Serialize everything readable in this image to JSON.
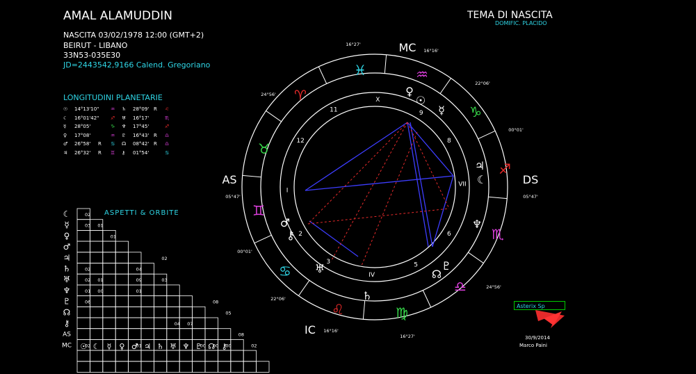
{
  "header": {
    "name": "AMAL ALAMUDDIN",
    "birth": "NASCITA 03/02/1978 12:00 (GMT+2)",
    "place": "BEIRUT - LIBANO",
    "coords": "33N53-035E30",
    "jd": "JD=2443542,9166  Calend. Gregoriano"
  },
  "chart_header": {
    "title": "TEMA DI NASCITA",
    "subtitle": "DOMIFIC. PLACIDO"
  },
  "longitudes": {
    "title": "LONGITUDINI PLANETARIE",
    "rows": [
      [
        "14°13'10\"",
        "",
        "28°09'",
        "R",
        "16°01'42\"",
        "",
        "16°17'",
        "",
        "28°05'",
        "",
        "17°45'",
        "",
        "17°08'",
        "",
        "16°43'",
        "R",
        "26°58'",
        "R",
        "08°42'",
        "R",
        "26°32'",
        "R",
        "01°54'",
        ""
      ]
    ],
    "r1": [
      "14°13'10\"",
      "28°09'",
      "R"
    ],
    "r2": [
      "16°01'42\"",
      "16°17'",
      ""
    ],
    "r3": [
      "28°05'",
      "17°45'",
      ""
    ],
    "r4": [
      "17°08'",
      "16°43'",
      "R"
    ],
    "r5": [
      "26°58'",
      "R",
      "08°42'",
      "R"
    ],
    "r6": [
      "26°32'",
      "R",
      "01°54'",
      ""
    ]
  },
  "aspects": {
    "title": "ASPETTI  &  ORBITE",
    "row_labels": [
      "AS",
      "MC"
    ],
    "cells": [
      "02",
      "03",
      "01",
      "01",
      "02",
      "02",
      "04",
      "02",
      "01",
      "09",
      "03",
      "01",
      "00",
      "01",
      "06",
      "08",
      "05",
      "04",
      "07",
      "08",
      "02",
      "00",
      "01",
      "00",
      "00",
      "02"
    ]
  },
  "wheel": {
    "angles": {
      "mc": "MC",
      "ic": "IC",
      "as": "AS",
      "ds": "DS"
    },
    "degrees": [
      "16°27'",
      "16°16'",
      "22°06'",
      "24°56'",
      "00°01'",
      "05°47'",
      "05°47'",
      "00°01'",
      "24°56'",
      "22°06'",
      "16°16'",
      "16°27'"
    ],
    "houses": [
      "I",
      "2",
      "3",
      "IV",
      "5",
      "6",
      "VII",
      "8",
      "9",
      "X",
      "11",
      "12"
    ]
  },
  "footer": {
    "software": "Asterix Sp",
    "date": "30/9/2014",
    "author": "Marco Paini"
  },
  "colors": {
    "accent": "#2fd6e6",
    "fire": "#e52a2a",
    "earth": "#37d94a",
    "air": "#2fd6e6",
    "water": "#e040e0"
  }
}
